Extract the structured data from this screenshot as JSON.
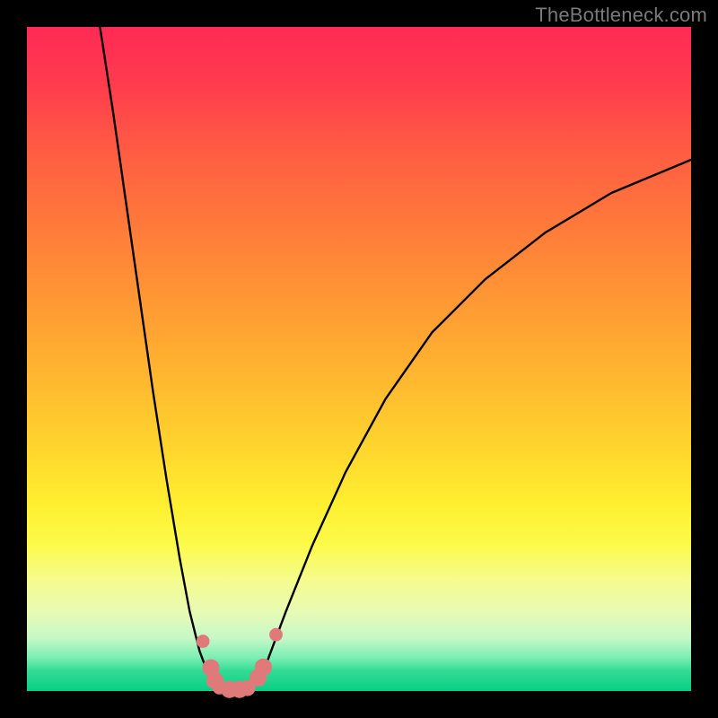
{
  "watermark": "TheBottleneck.com",
  "colors": {
    "gradient_top": "#ff2a55",
    "gradient_bottom": "#07cf83",
    "curve_stroke": "#000000",
    "marker_fill": "#e07a7a",
    "frame_bg": "#000000"
  },
  "chart_data": {
    "type": "line",
    "title": "",
    "xlabel": "",
    "ylabel": "",
    "xlim": [
      0,
      100
    ],
    "ylim": [
      0,
      100
    ],
    "grid": false,
    "legend": false,
    "series": [
      {
        "name": "left-branch",
        "x": [
          11,
          13,
          15,
          17,
          19,
          21,
          23,
          24.5,
          26,
          27.5,
          28.5
        ],
        "y": [
          100,
          87,
          73,
          59,
          45,
          32,
          20,
          12,
          6,
          2,
          0.5
        ]
      },
      {
        "name": "floor",
        "x": [
          28.5,
          30,
          31.5,
          33,
          34
        ],
        "y": [
          0.5,
          0.2,
          0.2,
          0.3,
          0.6
        ]
      },
      {
        "name": "right-branch",
        "x": [
          34,
          36,
          39,
          43,
          48,
          54,
          61,
          69,
          78,
          88,
          100
        ],
        "y": [
          0.6,
          4,
          12,
          22,
          33,
          44,
          54,
          62,
          69,
          75,
          80
        ]
      }
    ],
    "markers": [
      {
        "x": 26.5,
        "y": 7.5,
        "r": 1.0
      },
      {
        "x": 27.7,
        "y": 3.5,
        "r": 1.3
      },
      {
        "x": 28.3,
        "y": 1.6,
        "r": 1.3
      },
      {
        "x": 29.0,
        "y": 0.6,
        "r": 1.1
      },
      {
        "x": 30.5,
        "y": 0.25,
        "r": 1.3
      },
      {
        "x": 32.0,
        "y": 0.25,
        "r": 1.3
      },
      {
        "x": 33.2,
        "y": 0.45,
        "r": 1.2
      },
      {
        "x": 34.8,
        "y": 2.0,
        "r": 1.3
      },
      {
        "x": 35.6,
        "y": 3.6,
        "r": 1.3
      },
      {
        "x": 37.5,
        "y": 8.5,
        "r": 1.0
      }
    ]
  }
}
